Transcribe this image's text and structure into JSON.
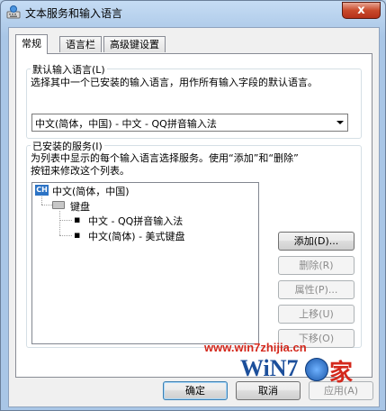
{
  "window": {
    "title": "文本服务和输入语言",
    "close_label": "x"
  },
  "tabs": [
    {
      "label": "常规",
      "active": true
    },
    {
      "label": "语言栏",
      "active": false
    },
    {
      "label": "高级键设置",
      "active": false
    }
  ],
  "default_language": {
    "group_label": "默认输入语言(L)",
    "description": "选择其中一个已安装的输入语言，用作所有输入字段的默认语言。",
    "selected": "中文(简体，中国) - 中文 - QQ拼音输入法"
  },
  "installed_services": {
    "group_label": "已安装的服务(I)",
    "description_line1": "为列表中显示的每个输入语言选择服务。使用“添加”和“删除”",
    "description_line2": "按钮来修改这个列表。",
    "tree": {
      "language_code": "CH",
      "language": "中文(简体，中国)",
      "category": "键盘",
      "services": [
        "中文 - QQ拼音输入法",
        "中文(简体) - 美式键盘"
      ]
    },
    "buttons": {
      "add": "添加(D)...",
      "remove": "删除(R)",
      "properties": "属性(P)...",
      "move_up": "上移(U)",
      "move_down": "下移(O)"
    }
  },
  "footer": {
    "ok": "确定",
    "cancel": "取消",
    "apply": "应用(A)"
  },
  "watermark": {
    "url": "www.win7zhijia.cn",
    "logo": "WiN7",
    "suffix": "家"
  }
}
